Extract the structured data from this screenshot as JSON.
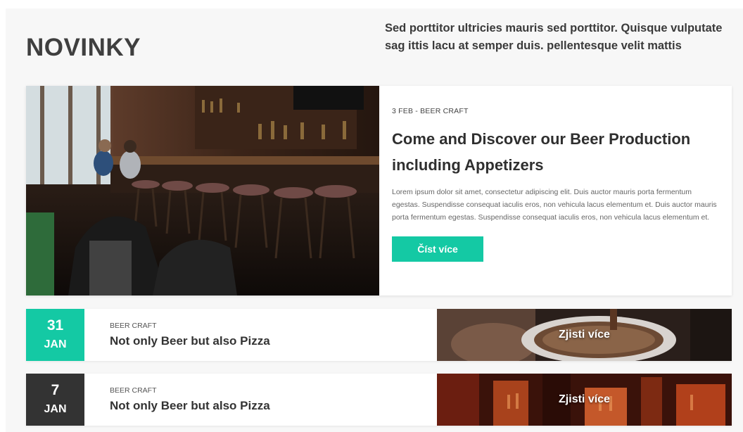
{
  "header": {
    "title": "NOVINKY",
    "intro": "Sed porttitor ultricies mauris sed porttitor. Quisque vulputate sag ittis lacu at semper duis. pellentesque velit mattis"
  },
  "featured": {
    "meta": "3 FEB - BEER CRAFT",
    "title": "Come and Discover our Beer Production including Appetizers",
    "text": "Lorem ipsum dolor sit amet, consectetur adipiscing elit. Duis auctor mauris porta fermentum egestas. Suspendisse consequat iaculis eros, non vehicula lacus elementum et. Duis auctor mauris porta fermentum egestas. Suspendisse consequat iaculis eros, non vehicula lacus elementum et.",
    "button_label": "Číst více"
  },
  "news": [
    {
      "day": "31",
      "month": "JAN",
      "category": "BEER CRAFT",
      "title": "Not only Beer but also Pizza",
      "link_label": "Zjisti více",
      "date_color": "#14c9a4"
    },
    {
      "day": "7",
      "month": "JAN",
      "category": "BEER CRAFT",
      "title": "Not only Beer but also Pizza",
      "link_label": "Zjisti více",
      "date_color": "#333333"
    }
  ],
  "colors": {
    "accent": "#14c9a4",
    "dark": "#333333"
  }
}
